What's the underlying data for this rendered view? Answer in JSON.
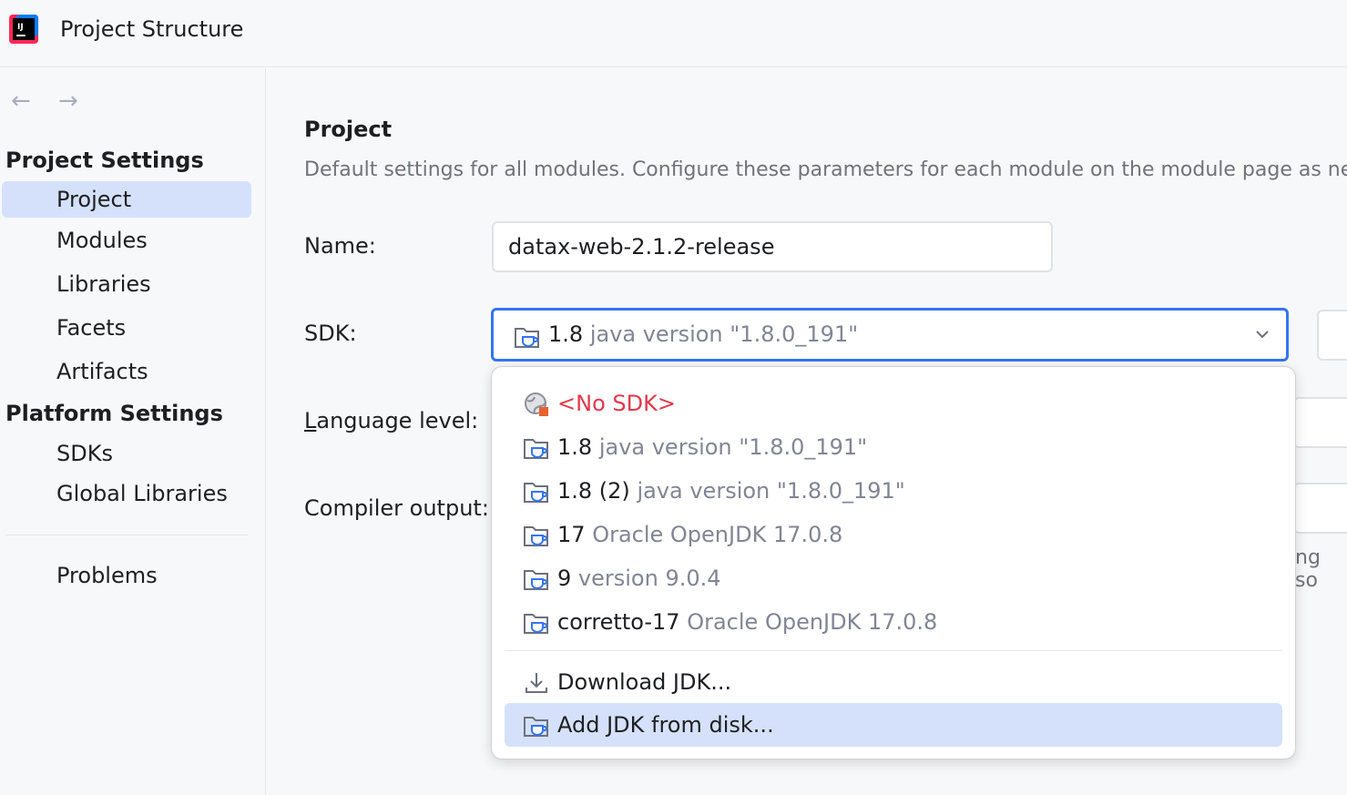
{
  "window": {
    "title": "Project Structure",
    "logo_text": "IJ"
  },
  "nav": {
    "back_icon": "←",
    "forward_icon": "→"
  },
  "sidebar": {
    "project_settings_heading": "Project Settings",
    "project_items": [
      {
        "label": "Project",
        "selected": true
      },
      {
        "label": "Modules"
      },
      {
        "label": "Libraries"
      },
      {
        "label": "Facets"
      },
      {
        "label": "Artifacts"
      }
    ],
    "platform_settings_heading": "Platform Settings",
    "platform_items": [
      {
        "label": "SDKs"
      },
      {
        "label": "Global Libraries"
      }
    ],
    "problems_label": "Problems"
  },
  "main": {
    "title": "Project",
    "description": "Default settings for all modules. Configure these parameters for each module on the module page as needed",
    "name_label": "Name:",
    "name_value": "datax-web-2.1.2-release",
    "sdk_label": "SDK:",
    "sdk_value": {
      "name": "1.8",
      "detail": "java version \"1.8.0_191\""
    },
    "language_level_label_mnemonic": "L",
    "language_level_label_rest": "anguage level:",
    "compiler_output_label": "Compiler output:",
    "hidden_text_fragment": "ng so"
  },
  "dropdown": {
    "options": [
      {
        "name": "<No SDK>",
        "detail": "",
        "icon": "globe-icon",
        "style": "red"
      },
      {
        "name": "1.8",
        "detail": "java version \"1.8.0_191\"",
        "icon": "jdk-folder-icon"
      },
      {
        "name": "1.8 (2)",
        "detail": "java version \"1.8.0_191\"",
        "icon": "jdk-folder-icon"
      },
      {
        "name": "17",
        "detail": "Oracle OpenJDK 17.0.8",
        "icon": "jdk-folder-icon"
      },
      {
        "name": "9",
        "detail": "version 9.0.4",
        "icon": "jdk-folder-icon"
      },
      {
        "name": "corretto-17",
        "detail": "Oracle OpenJDK 17.0.8",
        "icon": "jdk-folder-icon"
      }
    ],
    "actions": [
      {
        "label": "Download JDK...",
        "icon": "download-icon"
      },
      {
        "label": "Add JDK from disk...",
        "icon": "jdk-folder-icon",
        "selected": true
      }
    ]
  },
  "colors": {
    "accent": "#3574f0",
    "selection": "#d5e1fb",
    "muted_text": "#818594",
    "error_text": "#e0394b"
  }
}
